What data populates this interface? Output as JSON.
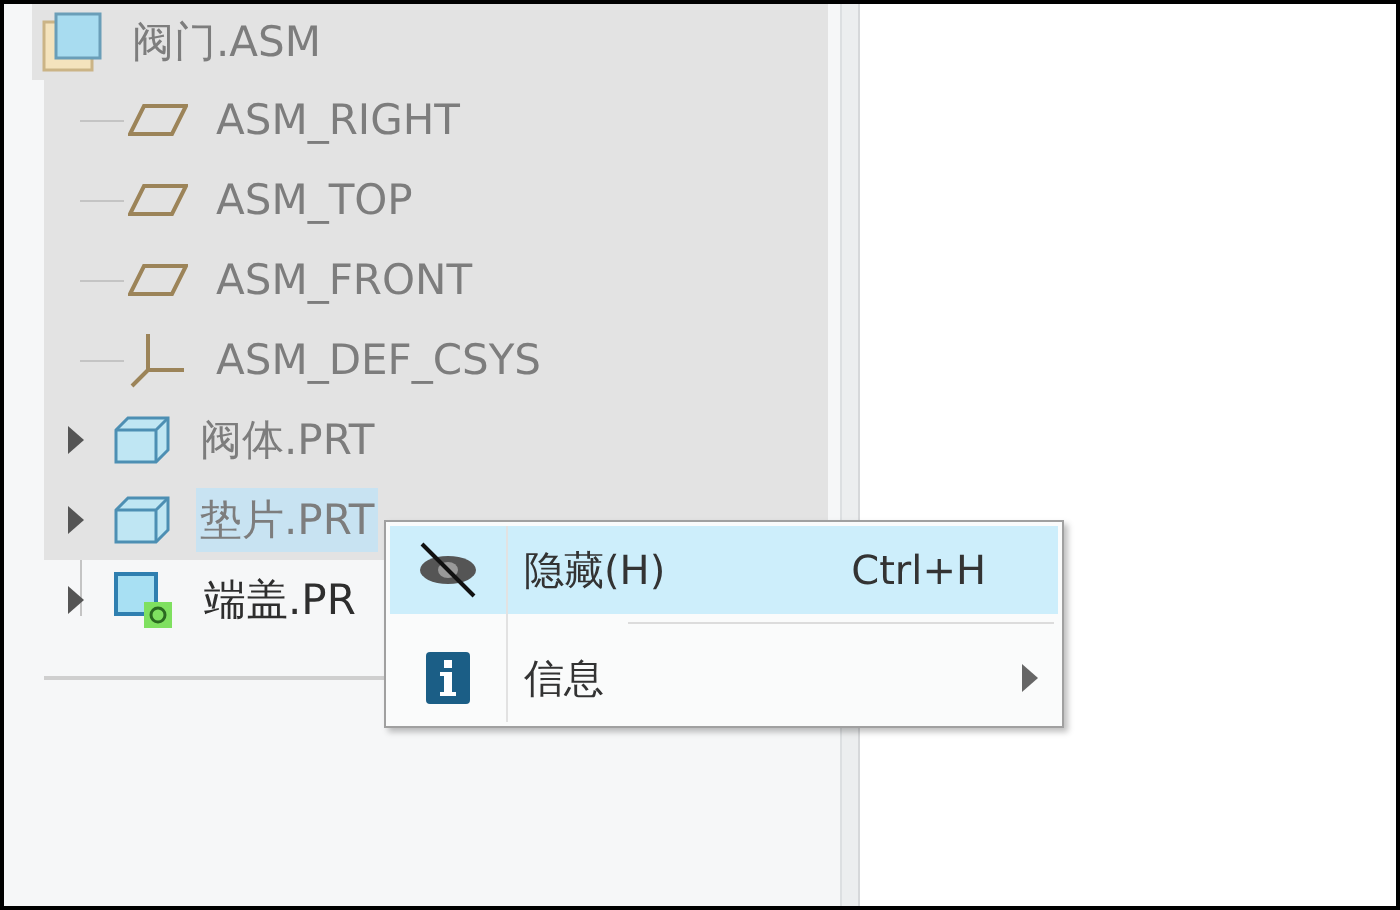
{
  "tree": {
    "root": {
      "label": "阀门.ASM",
      "dimmed": true,
      "children": [
        {
          "kind": "plane",
          "label": "ASM_RIGHT",
          "dimmed": true,
          "selected": false
        },
        {
          "kind": "plane",
          "label": "ASM_TOP",
          "dimmed": true,
          "selected": false
        },
        {
          "kind": "plane",
          "label": "ASM_FRONT",
          "dimmed": true,
          "selected": false
        },
        {
          "kind": "csys",
          "label": "ASM_DEF_CSYS",
          "dimmed": true,
          "selected": false
        },
        {
          "kind": "part",
          "label": "阀体.PRT",
          "dimmed": true,
          "selected": false,
          "expanded": false
        },
        {
          "kind": "part",
          "label": "垫片.PRT",
          "dimmed": true,
          "selected": true,
          "expanded": false
        },
        {
          "kind": "part-placed",
          "label": "端盖.PR",
          "dimmed": false,
          "selected": false,
          "expanded": false
        }
      ]
    }
  },
  "context_menu": {
    "items": [
      {
        "kind": "hide",
        "label": "隐藏(H)",
        "shortcut": "Ctrl+H",
        "selected": true,
        "submenu": false
      },
      {
        "kind": "info",
        "label": "信息",
        "selected": false,
        "submenu": true
      }
    ]
  }
}
